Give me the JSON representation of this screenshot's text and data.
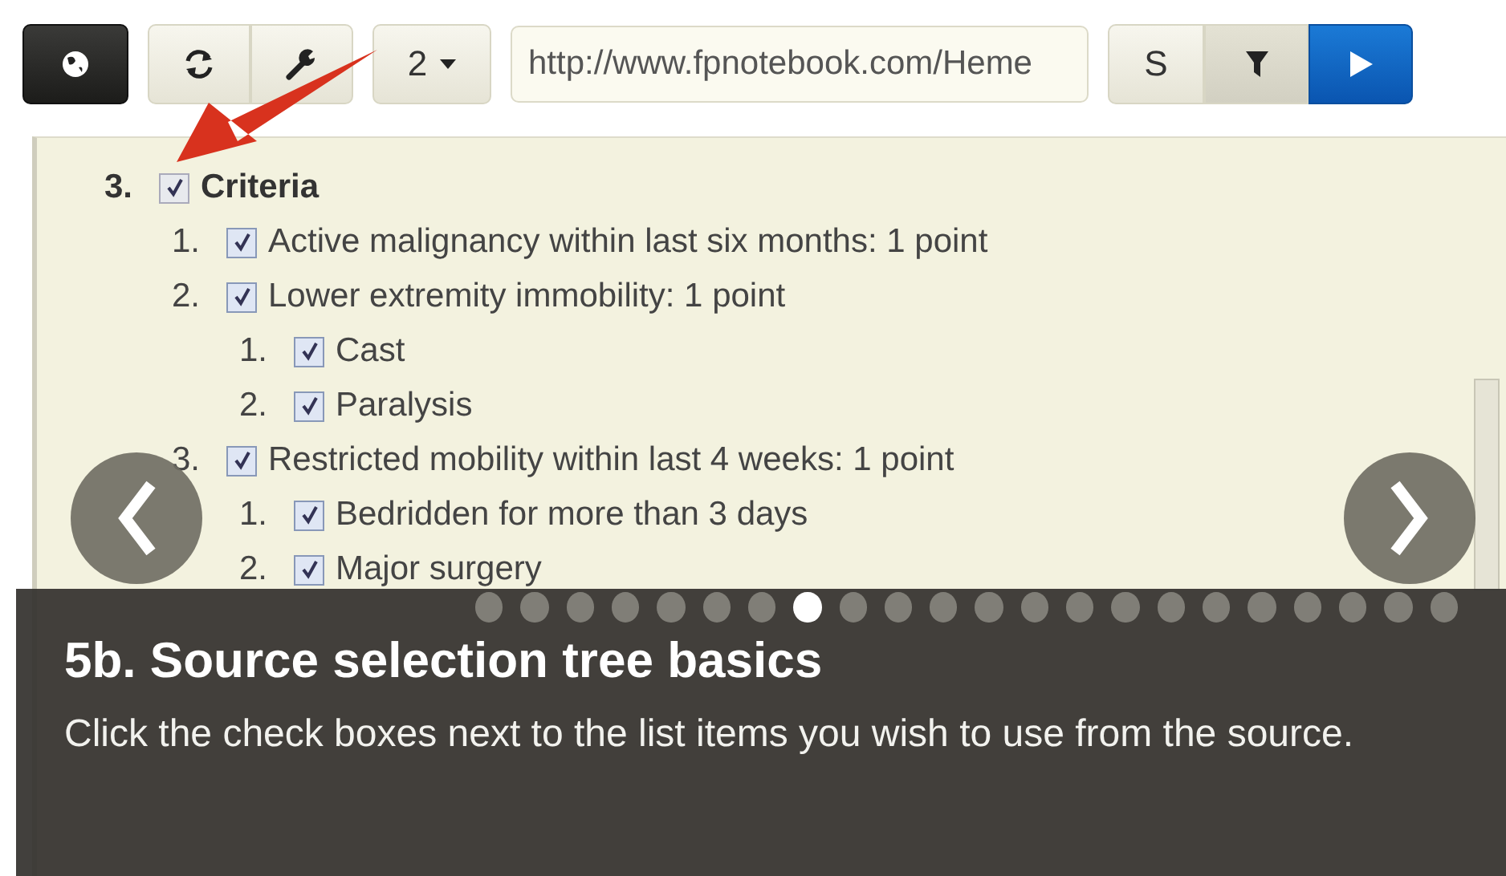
{
  "toolbar": {
    "page_count": "2",
    "url": "http://www.fpnotebook.com/Heme",
    "s_button": "S"
  },
  "tree": [
    {
      "number": "3.",
      "label": "Criteria",
      "checked": true,
      "children": [
        {
          "number": "1.",
          "label": "Active malignancy within last six months: 1 point",
          "checked": true
        },
        {
          "number": "2.",
          "label": "Lower extremity immobility: 1 point",
          "checked": true,
          "children": [
            {
              "number": "1.",
              "label": "Cast",
              "checked": true
            },
            {
              "number": "2.",
              "label": "Paralysis",
              "checked": true
            }
          ]
        },
        {
          "number": "3.",
          "label": "Restricted mobility within last 4 weeks: 1 point",
          "checked": true,
          "children": [
            {
              "number": "1.",
              "label": "Bedridden for more than 3 days",
              "checked": true
            },
            {
              "number": "2.",
              "label": "Major surgery",
              "checked": true
            }
          ]
        }
      ]
    }
  ],
  "caption": {
    "title": "5b. Source selection tree basics",
    "text": "Click the check boxes next to the list items you wish to use from the source.",
    "dots": [
      {
        "selected": false
      },
      {
        "selected": false
      },
      {
        "selected": false
      },
      {
        "selected": false
      },
      {
        "selected": false
      },
      {
        "selected": false
      },
      {
        "selected": false
      },
      {
        "selected": true
      },
      {
        "selected": false
      },
      {
        "selected": false
      },
      {
        "selected": false
      },
      {
        "selected": false
      },
      {
        "selected": false
      },
      {
        "selected": false
      },
      {
        "selected": false
      },
      {
        "selected": false
      },
      {
        "selected": false
      },
      {
        "selected": false
      },
      {
        "selected": false
      },
      {
        "selected": false
      },
      {
        "selected": false
      },
      {
        "selected": false
      }
    ]
  }
}
